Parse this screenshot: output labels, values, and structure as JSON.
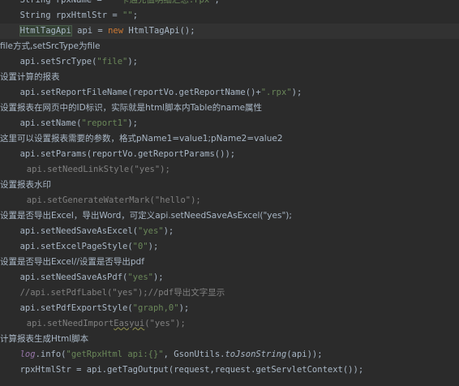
{
  "editor": {
    "lines": [
      {
        "indent": 3,
        "parts": [
          [
            "plain",
            "String rpxName = "
          ],
          [
            "str",
            "\"一卡通充值明细汇总.rpx\""
          ],
          [
            "plain",
            ";"
          ]
        ]
      },
      {
        "indent": 3,
        "parts": [
          [
            "plain",
            "String rpxHtmlStr = "
          ],
          [
            "str",
            "\"\""
          ],
          [
            "plain",
            ";"
          ]
        ]
      },
      {
        "indent": 3,
        "current": true,
        "parts": [
          [
            "hl",
            "HtmlTagApi"
          ],
          [
            "caret",
            ""
          ],
          [
            "plain",
            " api = "
          ],
          [
            "kw",
            "new "
          ],
          [
            "plain",
            "HtmlTagApi();"
          ]
        ]
      },
      {
        "indent": 0,
        "parts": [
          [
            "cmt-text",
            "file方式,setSrcType为file"
          ]
        ]
      },
      {
        "indent": 3,
        "parts": [
          [
            "plain",
            "api.setSrcType("
          ],
          [
            "str",
            "\"file\""
          ],
          [
            "plain",
            ");"
          ]
        ]
      },
      {
        "indent": 0,
        "parts": [
          [
            "cmt-text",
            "设置计算的报表"
          ]
        ]
      },
      {
        "indent": 3,
        "parts": [
          [
            "plain",
            "api.setReportFileName(reportVo.getReportName()+"
          ],
          [
            "str",
            "\".rpx\""
          ],
          [
            "plain",
            ");"
          ]
        ]
      },
      {
        "indent": 0,
        "parts": [
          [
            "cmt-text",
            "设置报表在网页中的ID标识，实际就是html脚本内Table的name属性"
          ]
        ]
      },
      {
        "indent": 3,
        "parts": [
          [
            "plain",
            "api.setName("
          ],
          [
            "str",
            "\"report1\""
          ],
          [
            "plain",
            ");"
          ]
        ]
      },
      {
        "indent": 0,
        "parts": [
          [
            "cmt-text",
            "这里可以设置报表需要的参数，格式pName1=value1;pName2=value2"
          ]
        ]
      },
      {
        "indent": 3,
        "parts": [
          [
            "plain",
            "api.setParams(reportVo.getReportParams());"
          ]
        ]
      },
      {
        "indent": 4,
        "parts": [
          [
            "cmt",
            "api.setNeedLinkStyle(\"yes\");"
          ]
        ]
      },
      {
        "indent": 0,
        "parts": [
          [
            "cmt-text",
            "设置报表水印"
          ]
        ]
      },
      {
        "indent": 4,
        "parts": [
          [
            "cmt",
            "api.setGenerateWaterMark(\"hello\");"
          ]
        ]
      },
      {
        "indent": 0,
        "parts": [
          [
            "cmt-text",
            "设置是否导出Excel，导出Word，可定义api.setNeedSaveAsExcel(\"yes\");"
          ]
        ]
      },
      {
        "indent": 3,
        "parts": [
          [
            "plain",
            "api.setNeedSaveAsExcel("
          ],
          [
            "str",
            "\"yes\""
          ],
          [
            "plain",
            ");"
          ]
        ]
      },
      {
        "indent": 3,
        "parts": [
          [
            "plain",
            "api.setExcelPageStyle("
          ],
          [
            "str",
            "\"0\""
          ],
          [
            "plain",
            ");"
          ]
        ]
      },
      {
        "indent": 0,
        "parts": [
          [
            "cmt-text",
            "设置是否导出Excel//设置是否导出pdf"
          ]
        ]
      },
      {
        "indent": 3,
        "parts": [
          [
            "plain",
            "api.setNeedSaveAsPdf("
          ],
          [
            "str",
            "\"yes\""
          ],
          [
            "plain",
            ");"
          ]
        ]
      },
      {
        "indent": 3,
        "parts": [
          [
            "cmt",
            "//api.setPdfLabel(\"yes\");//pdf导出文字显示"
          ]
        ]
      },
      {
        "indent": 3,
        "parts": [
          [
            "plain",
            "api.setPdfExportStyle("
          ],
          [
            "str",
            "\"graph,0\""
          ],
          [
            "plain",
            ");"
          ]
        ]
      },
      {
        "indent": 4,
        "parts": [
          [
            "cmt",
            "api.setNeedImport"
          ],
          [
            "cmt sq",
            "Easyui"
          ],
          [
            "cmt",
            "(\"yes\");"
          ]
        ]
      },
      {
        "indent": 0,
        "parts": [
          [
            "cmt-text",
            "计算报表生成Html脚本"
          ]
        ]
      },
      {
        "indent": 3,
        "parts": [
          [
            "field",
            "log"
          ],
          [
            "plain",
            ".info("
          ],
          [
            "str",
            "\"getRpxHtml api:{}\""
          ],
          [
            "plain",
            ", GsonUtils."
          ],
          [
            "static",
            "toJsonString"
          ],
          [
            "plain",
            "(api));"
          ]
        ]
      },
      {
        "indent": 3,
        "parts": [
          [
            "plain",
            "rpxHtmlStr = api.getTagOutput(request,request.getServletContext());"
          ]
        ]
      }
    ]
  }
}
